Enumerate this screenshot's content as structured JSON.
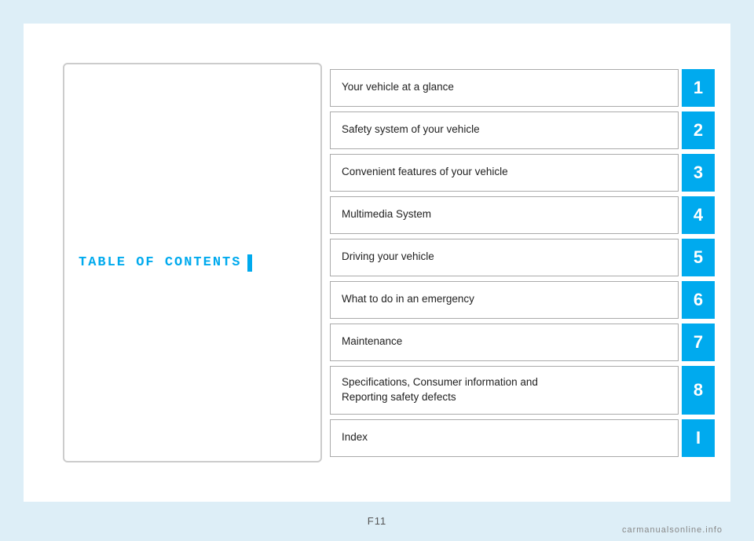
{
  "page": {
    "background_color": "#ddeef7",
    "page_number": "F11",
    "watermark": "carmanualsonline.info"
  },
  "toc": {
    "title": "TABLE OF CONTENTS",
    "title_color": "#00aaee",
    "accent_color": "#00aaee",
    "items": [
      {
        "id": 1,
        "label": "Your vehicle at a glance",
        "number": "1",
        "tall": false
      },
      {
        "id": 2,
        "label": "Safety system of your vehicle",
        "number": "2",
        "tall": false
      },
      {
        "id": 3,
        "label": "Convenient features of your vehicle",
        "number": "3",
        "tall": false
      },
      {
        "id": 4,
        "label": "Multimedia System",
        "number": "4",
        "tall": false
      },
      {
        "id": 5,
        "label": "Driving your vehicle",
        "number": "5",
        "tall": false
      },
      {
        "id": 6,
        "label": "What to do in an emergency",
        "number": "6",
        "tall": false
      },
      {
        "id": 7,
        "label": "Maintenance",
        "number": "7",
        "tall": false
      },
      {
        "id": 8,
        "label": "Specifications, Consumer information and\nReporting safety defects",
        "number": "8",
        "tall": true
      },
      {
        "id": 9,
        "label": "Index",
        "number": "I",
        "tall": false
      }
    ]
  }
}
